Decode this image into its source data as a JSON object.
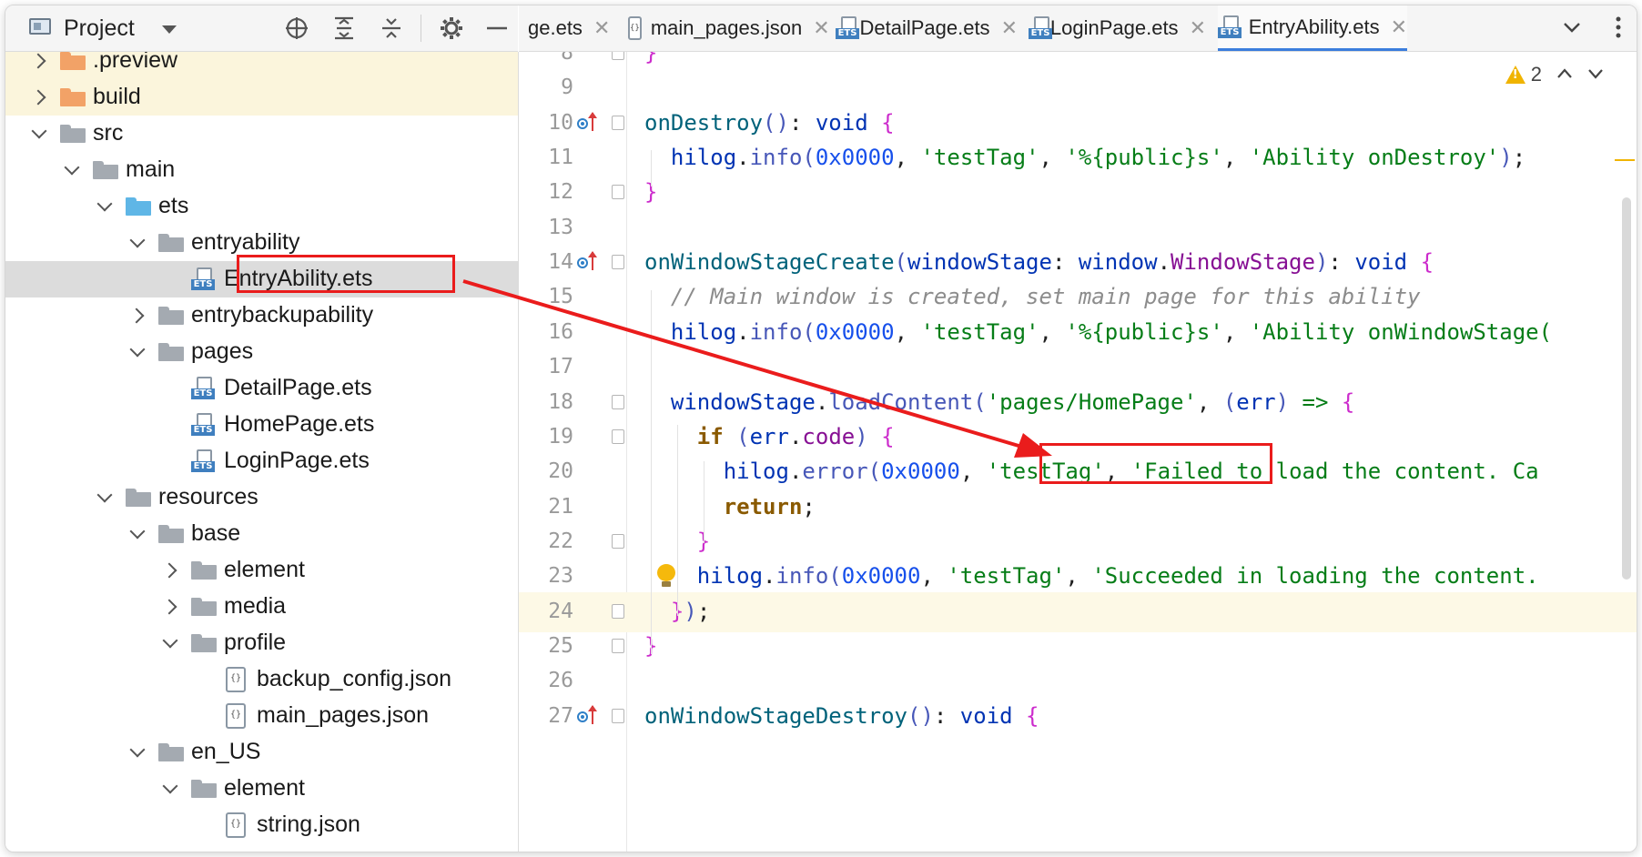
{
  "project_panel": {
    "title": "Project",
    "toolbar_icons": [
      "crosshair-icon",
      "expand-all-icon",
      "collapse-all-icon",
      "gear-icon",
      "minimize-icon"
    ],
    "tree": [
      {
        "label": ".preview",
        "depth": 2,
        "icon": "folder-orange",
        "arrow": "right"
      },
      {
        "label": "build",
        "depth": 2,
        "icon": "folder-orange",
        "arrow": "right"
      },
      {
        "label": "src",
        "depth": 2,
        "icon": "folder",
        "arrow": "down"
      },
      {
        "label": "main",
        "depth": 3,
        "icon": "folder",
        "arrow": "down"
      },
      {
        "label": "ets",
        "depth": 4,
        "icon": "folder-blue",
        "arrow": "down"
      },
      {
        "label": "entryability",
        "depth": 5,
        "icon": "folder",
        "arrow": "down"
      },
      {
        "label": "EntryAbility.ets",
        "depth": 6,
        "icon": "ets-file",
        "arrow": "none",
        "selected": true
      },
      {
        "label": "entrybackupability",
        "depth": 5,
        "icon": "folder",
        "arrow": "right"
      },
      {
        "label": "pages",
        "depth": 5,
        "icon": "folder",
        "arrow": "down"
      },
      {
        "label": "DetailPage.ets",
        "depth": 6,
        "icon": "ets-file",
        "arrow": "none"
      },
      {
        "label": "HomePage.ets",
        "depth": 6,
        "icon": "ets-file",
        "arrow": "none"
      },
      {
        "label": "LoginPage.ets",
        "depth": 6,
        "icon": "ets-file",
        "arrow": "none"
      },
      {
        "label": "resources",
        "depth": 4,
        "icon": "folder",
        "arrow": "down"
      },
      {
        "label": "base",
        "depth": 5,
        "icon": "folder",
        "arrow": "down"
      },
      {
        "label": "element",
        "depth": 6,
        "icon": "folder",
        "arrow": "right"
      },
      {
        "label": "media",
        "depth": 6,
        "icon": "folder",
        "arrow": "right"
      },
      {
        "label": "profile",
        "depth": 6,
        "icon": "folder",
        "arrow": "down"
      },
      {
        "label": "backup_config.json",
        "depth": 7,
        "icon": "json-file",
        "arrow": "none"
      },
      {
        "label": "main_pages.json",
        "depth": 7,
        "icon": "json-file",
        "arrow": "none"
      },
      {
        "label": "en_US",
        "depth": 5,
        "icon": "folder",
        "arrow": "down"
      },
      {
        "label": "element",
        "depth": 6,
        "icon": "folder",
        "arrow": "down"
      },
      {
        "label": "string.json",
        "depth": 7,
        "icon": "json-file",
        "arrow": "none"
      }
    ]
  },
  "tabs": [
    {
      "label": "ge.ets",
      "icon": "none",
      "active": false
    },
    {
      "label": "main_pages.json",
      "icon": "json-file",
      "active": false
    },
    {
      "label": "DetailPage.ets",
      "icon": "ets-file",
      "active": false
    },
    {
      "label": "LoginPage.ets",
      "icon": "ets-file",
      "active": false
    },
    {
      "label": "EntryAbility.ets",
      "icon": "ets-file",
      "active": true
    }
  ],
  "editor": {
    "warning_count": "2",
    "current_line": "24",
    "lines": [
      {
        "n": "8",
        "text": "}",
        "html": "<span class='br'>}</span>"
      },
      {
        "n": "9",
        "text": ""
      },
      {
        "n": "10",
        "text": "onDestroy(): void {",
        "override": true
      },
      {
        "n": "11",
        "text": "  hilog.info(0x0000, 'testTag', '%{public}s', 'Ability onDestroy');"
      },
      {
        "n": "12",
        "text": "}"
      },
      {
        "n": "13",
        "text": ""
      },
      {
        "n": "14",
        "text": "onWindowStageCreate(windowStage: window.WindowStage): void {",
        "override": true
      },
      {
        "n": "15",
        "text": "  // Main window is created, set main page for this ability"
      },
      {
        "n": "16",
        "text": "  hilog.info(0x0000, 'testTag', '%{public}s', 'Ability onWindowStage("
      },
      {
        "n": "17",
        "text": ""
      },
      {
        "n": "18",
        "text": "  windowStage.loadContent('pages/HomePage', (err) => {"
      },
      {
        "n": "19",
        "text": "    if (err.code) {"
      },
      {
        "n": "20",
        "text": "      hilog.error(0x0000, 'testTag', 'Failed to load the content. Ca"
      },
      {
        "n": "21",
        "text": "      return;"
      },
      {
        "n": "22",
        "text": "    }"
      },
      {
        "n": "23",
        "text": "    hilog.info(0x0000, 'testTag', 'Succeeded in loading the content."
      },
      {
        "n": "24",
        "text": "  });"
      },
      {
        "n": "25",
        "text": "}"
      },
      {
        "n": "26",
        "text": ""
      },
      {
        "n": "27",
        "text": "onWindowStageDestroy(): void {",
        "override": true
      }
    ]
  }
}
